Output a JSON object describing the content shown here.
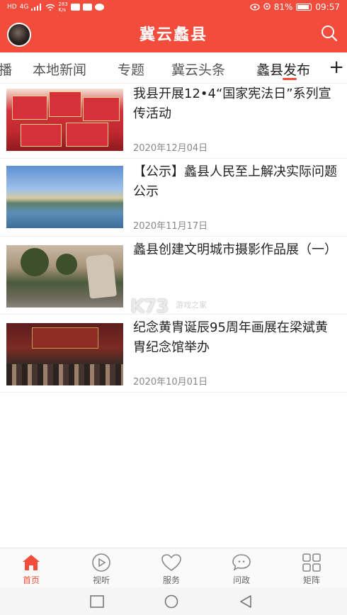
{
  "status_bar": {
    "left_badge": "HD",
    "network": "4G",
    "speed": "283\nK/s",
    "battery_percent": "81%",
    "time": "09:57"
  },
  "header": {
    "title": "冀云蠡县"
  },
  "tabs": [
    {
      "label": "播",
      "active": false
    },
    {
      "label": "本地新闻",
      "active": false
    },
    {
      "label": "专题",
      "active": false
    },
    {
      "label": "冀云头条",
      "active": false
    },
    {
      "label": "蠡县发布",
      "active": true
    }
  ],
  "tab_add": "+",
  "news": [
    {
      "headline": "我县开展12•4“国家宪法日”系列宣传活动",
      "date": "2020年12月04日"
    },
    {
      "headline": "【公示】蠡县人民至上解决实际问题公示",
      "date": "2020年11月17日"
    },
    {
      "headline": "蠡县创建文明城市摄影作品展（一）",
      "date": ""
    },
    {
      "headline": "纪念黄胄诞辰95周年画展在梁斌黄胄纪念馆举办",
      "date": "2020年10月01日"
    }
  ],
  "watermark": {
    "logo": "K73",
    "text": "游戏之家"
  },
  "bottom_nav": [
    {
      "label": "首页",
      "icon": "home-icon",
      "active": true
    },
    {
      "label": "视听",
      "icon": "play-icon",
      "active": false
    },
    {
      "label": "服务",
      "icon": "heart-icon",
      "active": false
    },
    {
      "label": "问政",
      "icon": "chat-icon",
      "active": false
    },
    {
      "label": "矩阵",
      "icon": "grid-icon",
      "active": false
    }
  ],
  "colors": {
    "accent": "#f24c3d",
    "text": "#222222",
    "muted": "#888888"
  }
}
